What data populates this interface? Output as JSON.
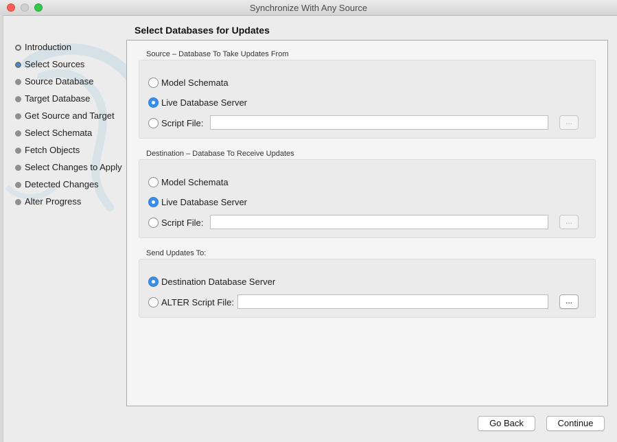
{
  "window": {
    "title": "Synchronize With Any Source"
  },
  "wizard": {
    "steps": [
      {
        "label": "Introduction",
        "state": "done"
      },
      {
        "label": "Select Sources",
        "state": "current"
      },
      {
        "label": "Source Database",
        "state": "pending"
      },
      {
        "label": "Target Database",
        "state": "pending"
      },
      {
        "label": "Get Source and Target",
        "state": "pending"
      },
      {
        "label": "Select Schemata",
        "state": "pending"
      },
      {
        "label": "Fetch Objects",
        "state": "pending"
      },
      {
        "label": "Select Changes to Apply",
        "state": "pending"
      },
      {
        "label": "Detected Changes",
        "state": "pending"
      },
      {
        "label": "Alter Progress",
        "state": "pending"
      }
    ]
  },
  "page": {
    "heading": "Select Databases for Updates",
    "source": {
      "title": "Source – Database To Take Updates From",
      "options": [
        {
          "label": "Model Schemata",
          "checked": false
        },
        {
          "label": "Live Database Server",
          "checked": true
        },
        {
          "label": "Script File:",
          "checked": false
        }
      ],
      "script_file_value": "",
      "browse_label": "...",
      "browse_enabled": false
    },
    "destination": {
      "title": "Destination – Database To Receive Updates",
      "options": [
        {
          "label": "Model Schemata",
          "checked": false
        },
        {
          "label": "Live Database Server",
          "checked": true
        },
        {
          "label": "Script File:",
          "checked": false
        }
      ],
      "script_file_value": "",
      "browse_label": "...",
      "browse_enabled": false
    },
    "send_to": {
      "title": "Send Updates To:",
      "options": [
        {
          "label": "Destination Database Server",
          "checked": true
        },
        {
          "label": "ALTER Script File:",
          "checked": false
        }
      ],
      "script_file_value": "",
      "browse_label": "...",
      "browse_enabled": true
    }
  },
  "footer": {
    "back_label": "Go Back",
    "continue_label": "Continue"
  },
  "colors": {
    "accent": "#3b8de6",
    "watermark": "#b9d3e0"
  }
}
